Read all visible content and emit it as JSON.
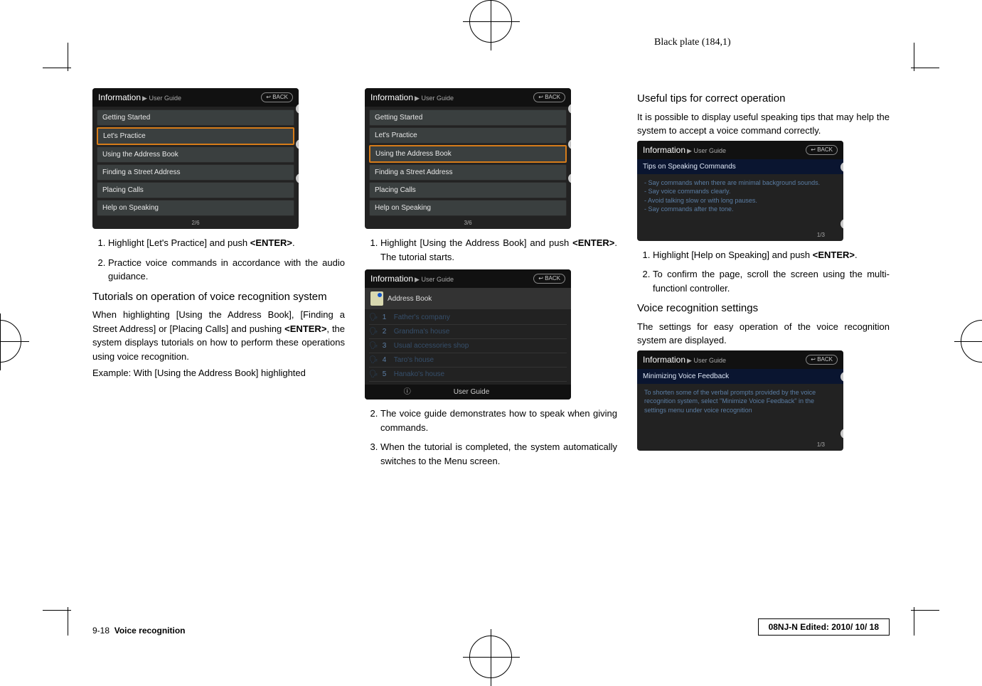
{
  "header_note": "Black plate (184,1)",
  "col1": {
    "screen": {
      "title": "Information",
      "subtitle": "▶ User Guide",
      "back": "↩ BACK",
      "items": [
        "Getting Started",
        "Let's Practice",
        "Using the Address Book",
        "Finding a Street Address",
        "Placing Calls",
        "Help on Speaking"
      ],
      "page": "2/6"
    },
    "li1a": "Highlight [Let's Practice] and push ",
    "li1b": "<ENTER>",
    "li1c": ".",
    "li2": "Practice voice commands in accordance with the audio guidance.",
    "h1": "Tutorials on operation of voice recognition system",
    "p1a": "When highlighting [Using the Address Book], [Finding a Street Address] or [Placing Calls] and pushing ",
    "p1b": "<ENTER>",
    "p1c": ", the system displays tutorials on how to perform these operations using voice recognition.",
    "p2": "Example: With [Using the Address Book] highlighted"
  },
  "col2": {
    "screen": {
      "title": "Information",
      "subtitle": "▶ User Guide",
      "back": "↩ BACK",
      "items": [
        "Getting Started",
        "Let's Practice",
        "Using the Address Book",
        "Finding a Street Address",
        "Placing Calls",
        "Help on Speaking"
      ],
      "page": "3/6"
    },
    "li1a": "Highlight [Using the Address Book] and push ",
    "li1b": "<ENTER>",
    "li1c": ". The tutorial starts.",
    "ab": {
      "title": "Information",
      "subtitle": "▶ User Guide",
      "back": "↩ BACK",
      "header": "Address Book",
      "rows": [
        {
          "n": "1",
          "t": "Father's company"
        },
        {
          "n": "2",
          "t": "Grandma's house"
        },
        {
          "n": "3",
          "t": "Usual accessories shop"
        },
        {
          "n": "4",
          "t": "Taro's house"
        },
        {
          "n": "5",
          "t": "Hanako's house"
        }
      ],
      "footer_info": "ⓘ",
      "footer": "User Guide"
    },
    "li2": "The voice guide demonstrates how to speak when giving commands.",
    "li3": "When the tutorial is completed, the system automatically switches to the Menu screen."
  },
  "col3": {
    "h1": "Useful tips for correct operation",
    "p1": "It is possible to display useful speaking tips that may help the system to accept a voice command correctly.",
    "tips": {
      "title": "Information",
      "subtitle": "▶ User Guide",
      "back": "↩ BACK",
      "bar": "Tips on Speaking Commands",
      "body": "- Say commands when there are minimal background sounds.\n- Say voice commands clearly.\n- Avoid talking slow or with long pauses.\n- Say commands after the tone.",
      "page": "1/3"
    },
    "li1a": "Highlight [Help on Speaking] and push ",
    "li1b": "<ENTER>",
    "li1c": ".",
    "li2": "To confirm the page, scroll the screen using the multi-functionl controller.",
    "h2": "Voice recognition settings",
    "p2": "The settings for easy operation of the voice recognition system are displayed.",
    "vfb": {
      "title": "Information",
      "subtitle": "▶ User Guide",
      "back": "↩ BACK",
      "bar": "Minimizing Voice Feedback",
      "body": "To shorten some of the verbal prompts provided by the voice recognition system, select \"Minimize Voice Feedback\" in the settings menu under voice recognition",
      "page": "1/3"
    }
  },
  "footer": {
    "page_num": "9-18",
    "section": "Voice recognition",
    "edit": "08NJ-N Edited:  2010/ 10/ 18"
  }
}
